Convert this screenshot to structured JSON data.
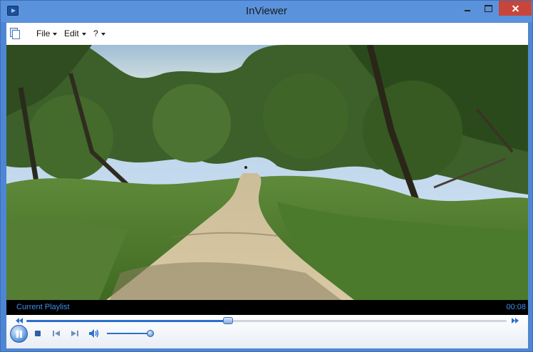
{
  "window": {
    "title": "InViewer",
    "icon": "media-player-icon",
    "controls": [
      "minimize-icon",
      "maximize-icon",
      "close-icon"
    ]
  },
  "menu": {
    "icon": "document-pages-icon",
    "items": [
      {
        "label": "File"
      },
      {
        "label": "Edit"
      },
      {
        "label": "?"
      }
    ]
  },
  "video": {
    "content": "forest trail"
  },
  "status": {
    "playlist_label": "Current Playlist",
    "time": "00:08"
  },
  "playback": {
    "seek_progress": 0.42,
    "volume_level": 0.92,
    "icons": [
      "rewind-icon",
      "fast-forward-icon",
      "pause-icon",
      "stop-icon",
      "previous-track-icon",
      "next-track-icon",
      "volume-icon"
    ]
  },
  "colors": {
    "title_bar": "#5a92dc",
    "close_button": "#c7453a",
    "accent": "#2b6fcf",
    "status_text": "#3f8fe8"
  }
}
